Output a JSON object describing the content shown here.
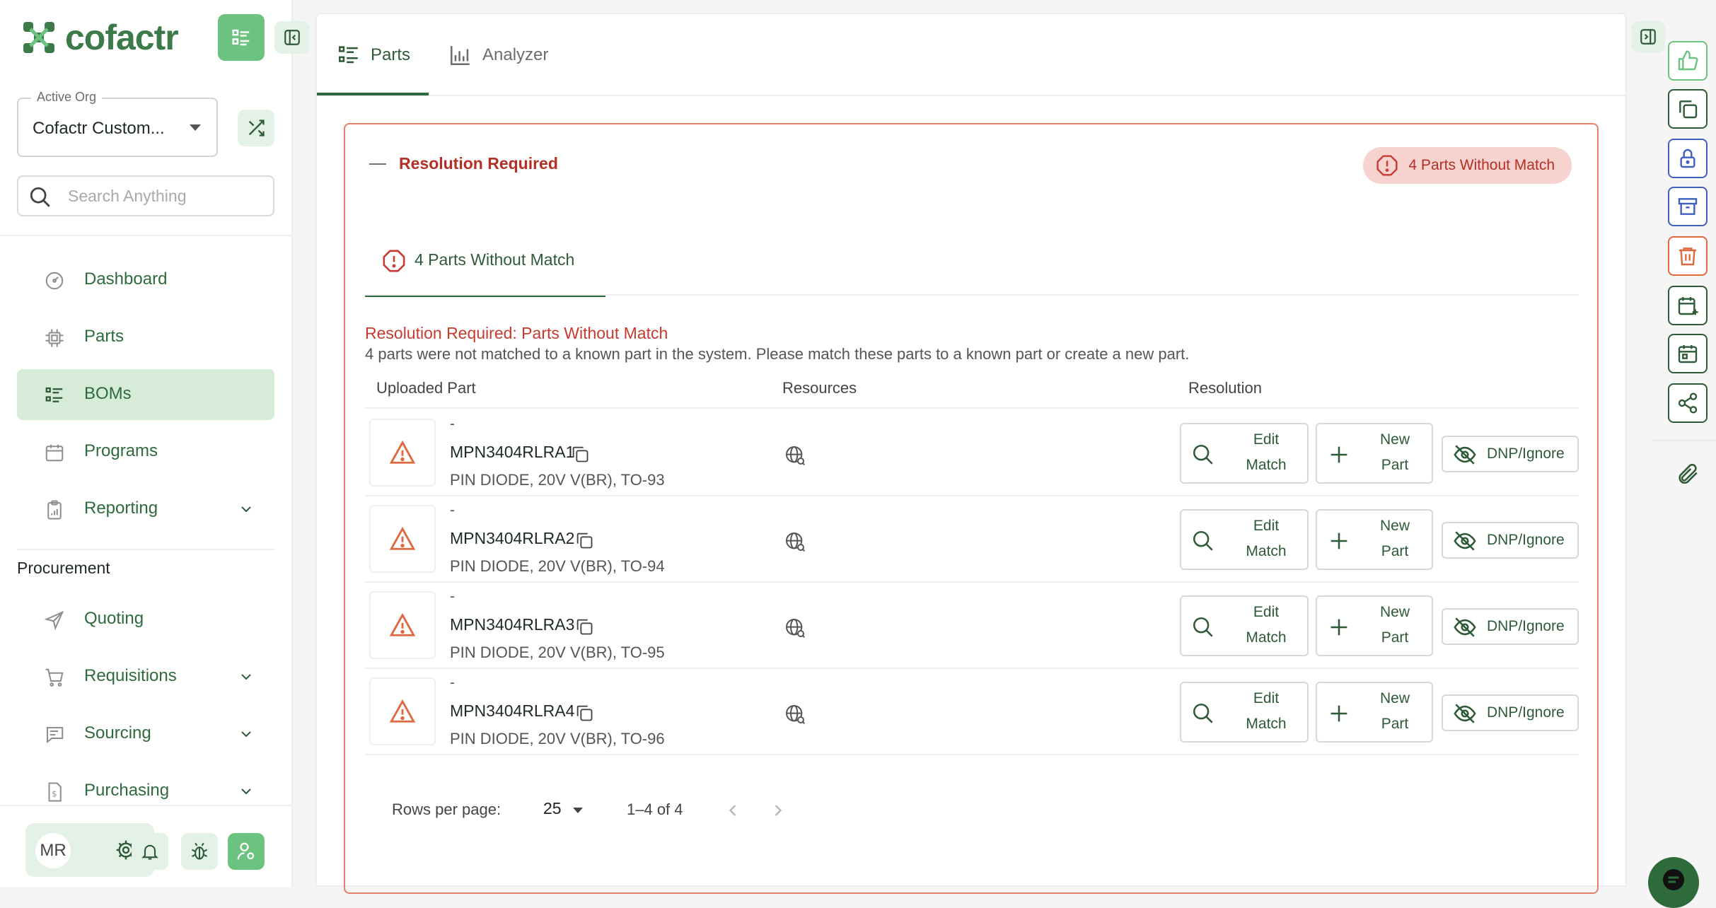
{
  "app": {
    "name": "cofactr"
  },
  "sidebar": {
    "active_org_label": "Active Org",
    "active_org_value": "Cofactr Custom...",
    "search_placeholder": "Search Anything",
    "nav": [
      {
        "label": "Dashboard",
        "icon": "dashboard-icon"
      },
      {
        "label": "Parts",
        "icon": "chip-icon"
      },
      {
        "label": "BOMs",
        "icon": "list-icon",
        "active": true
      },
      {
        "label": "Programs",
        "icon": "calendar-icon"
      },
      {
        "label": "Reporting",
        "icon": "clipboard-icon",
        "expandable": true
      }
    ],
    "section_label": "Procurement",
    "procurement": [
      {
        "label": "Quoting",
        "icon": "send-icon"
      },
      {
        "label": "Requisitions",
        "icon": "cart-icon",
        "expandable": true
      },
      {
        "label": "Sourcing",
        "icon": "chat-search-icon",
        "expandable": true
      },
      {
        "label": "Purchasing",
        "icon": "invoice-icon",
        "expandable": true
      }
    ],
    "user_initials": "MR"
  },
  "tabs": [
    {
      "label": "Parts",
      "icon": "list-icon",
      "active": true
    },
    {
      "label": "Analyzer",
      "icon": "bar-chart-icon"
    }
  ],
  "card": {
    "title": "Resolution Required",
    "badge": "4 Parts Without Match",
    "sub_tab": "4 Parts Without Match",
    "res_title": "Resolution Required: Parts Without Match",
    "res_desc": "4 parts were not matched to a known part in the system. Please match these parts to a known part or create a new part.",
    "columns": [
      "Uploaded Part",
      "Resources",
      "Resolution"
    ],
    "rows": [
      {
        "dash": "-",
        "mpn": "MPN3404RLRA1",
        "desc": "PIN DIODE, 20V V(BR), TO-93"
      },
      {
        "dash": "-",
        "mpn": "MPN3404RLRA2",
        "desc": "PIN DIODE, 20V V(BR), TO-94"
      },
      {
        "dash": "-",
        "mpn": "MPN3404RLRA3",
        "desc": "PIN DIODE, 20V V(BR), TO-95"
      },
      {
        "dash": "-",
        "mpn": "MPN3404RLRA4",
        "desc": "PIN DIODE, 20V V(BR), TO-96"
      }
    ],
    "buttons": {
      "edit_1": "Edit",
      "edit_2": "Match",
      "new_1": "New",
      "new_2": "Part",
      "dnp": "DNP/Ignore"
    },
    "pager": {
      "rows_label": "Rows per page:",
      "rows_value": "25",
      "range": "1–4 of 4"
    }
  },
  "colors": {
    "brand": "#3c7a4a",
    "accent_green": "#6cc27f",
    "error": "#c83a2f",
    "blue": "#3f5fbf",
    "orange": "#e0683f"
  },
  "right_rail": [
    "thumbs-up-icon",
    "copy-icon",
    "lock-icon",
    "archive-icon",
    "trash-icon",
    "calendar-plus-icon",
    "calendar-icon",
    "share-icon",
    "paperclip-icon"
  ]
}
